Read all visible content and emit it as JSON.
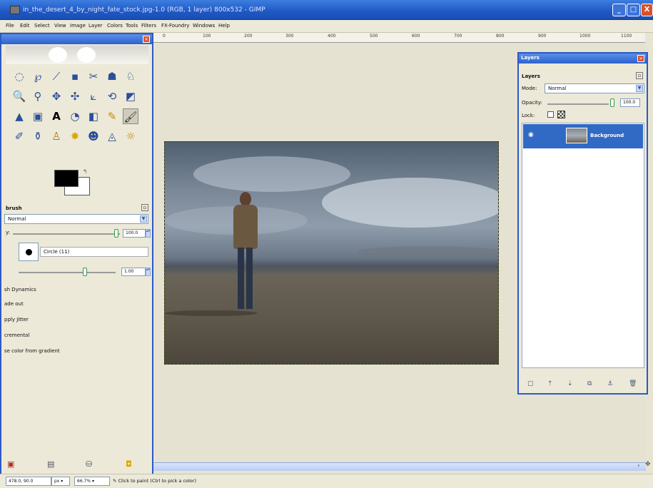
{
  "window": {
    "title": "in_the_desert_4_by_night_fate_stock.jpg-1.0 (RGB, 1 layer) 800x532 - GIMP",
    "minimize_label": "_",
    "maximize_label": "□",
    "close_label": "X"
  },
  "menu": {
    "items": [
      "File",
      "Edit",
      "Select",
      "View",
      "Image",
      "Layer",
      "Colors",
      "Tools",
      "Filters",
      "FX-Foundry",
      "Windows",
      "Help"
    ]
  },
  "ruler": {
    "ticks": [
      "0",
      "100",
      "200",
      "300",
      "400",
      "500",
      "600",
      "700",
      "800",
      "900",
      "1000",
      "1100"
    ]
  },
  "toolbox": {
    "tool_icons": [
      "rect-select-icon",
      "lasso-icon",
      "magic-wand-icon",
      "color-select-icon",
      "scissors-icon",
      "paths-icon",
      "color-picker-icon",
      "zoom-icon",
      "measure-icon",
      "move-icon",
      "align-icon",
      "crop-icon",
      "rotate-icon",
      "perspective-icon",
      "flip-icon",
      "scale-icon",
      "text-icon",
      "bucket-fill-icon",
      "blend-icon",
      "pencil-icon",
      "paintbrush-icon",
      "airbrush-icon",
      "clone-icon",
      "heal-icon",
      "ink-icon",
      "smudge-icon",
      "dodge-icon",
      "burn-icon"
    ],
    "brush_title": "brush",
    "mode_value": "Normal",
    "opacity_label": "y:",
    "opacity_value": "100.0",
    "brush_name": "Circle (11)",
    "scale_value": "1.00",
    "options": [
      "sh Dynamics",
      "ade out",
      "pply Jitter",
      "cremental",
      "se color from gradient"
    ]
  },
  "layers": {
    "dialog_title": "Layers",
    "tab_title": "Layers",
    "mode_label": "Mode:",
    "mode_value": "Normal",
    "opacity_label": "Opacity:",
    "opacity_value": "100.0",
    "lock_label": "Lock:",
    "layer_name": "Background"
  },
  "status": {
    "coords": "478.0, 90.0",
    "unit": "px",
    "zoom": "66.7%",
    "message": "Click to paint (Ctrl to pick a color)"
  }
}
